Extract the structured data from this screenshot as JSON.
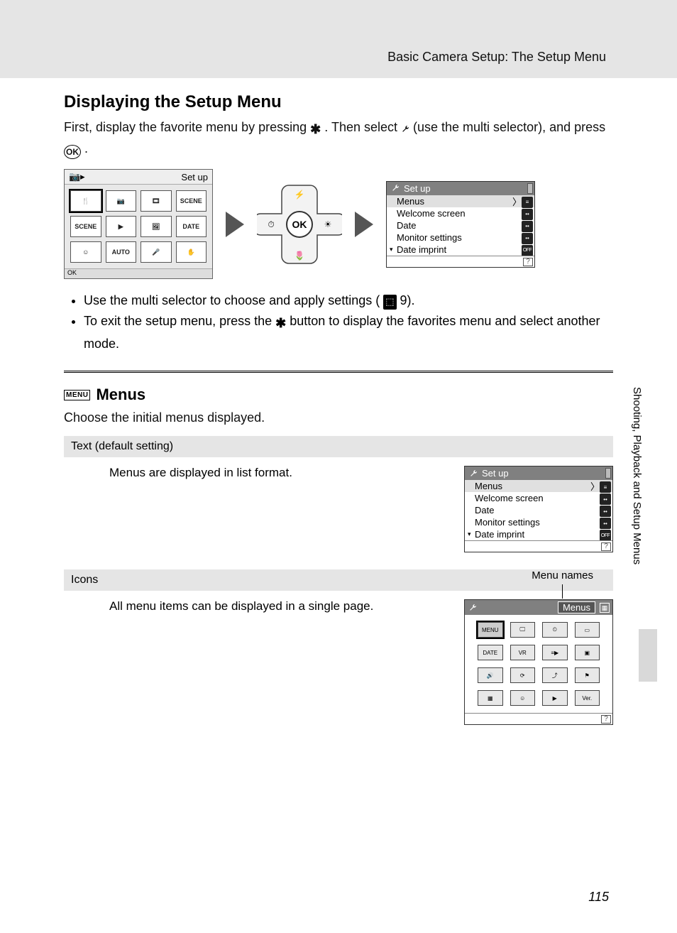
{
  "running_head": "Basic Camera Setup: The Setup Menu",
  "section1": {
    "title": "Displaying the Setup Menu",
    "intro_a": "First, display the favorite menu by pressing ",
    "intro_b": ". Then select ",
    "intro_c": " (use the multi selector), and press ",
    "intro_d": "."
  },
  "fav_panel": {
    "head_right": "Set up",
    "foot": "OK",
    "cells": [
      "🍴",
      "📷",
      "🎞",
      "SCENE",
      "SCENE",
      "▶",
      "🖼",
      "DATE",
      "☺",
      "AUTO",
      "🎤",
      "✋"
    ]
  },
  "setup_panel": {
    "title": "Set up",
    "rows": [
      {
        "label": "Menus",
        "badge": "≡",
        "sel": true
      },
      {
        "label": "Welcome screen",
        "badge": "••"
      },
      {
        "label": "Date",
        "badge": "••"
      },
      {
        "label": "Monitor settings",
        "badge": "••"
      },
      {
        "label": "Date imprint",
        "badge": "OFF",
        "tri": true
      }
    ]
  },
  "bullets": {
    "b1a": "Use the multi selector to choose and apply settings (",
    "b1b": " 9).",
    "b2a": "To exit the setup menu, press the ",
    "b2b": " button to display the favorites menu and select another mode."
  },
  "menus_section": {
    "icon_text": "MENU",
    "title": "Menus",
    "intro": "Choose the initial menus displayed."
  },
  "opt_text": {
    "header": "Text (default setting)",
    "desc": "Menus are displayed in list format."
  },
  "opt_icons": {
    "header": "Icons",
    "desc": "All menu items can be displayed in a single page.",
    "callout": "Menu names"
  },
  "icons_panel": {
    "title": "Menus",
    "cells": [
      "MENU",
      "🖵",
      "⏲",
      "▭",
      "DATE",
      "VR",
      "≡▶",
      "▣",
      "🔊",
      "⟳",
      "⤴",
      "⚑",
      "▦",
      "☺",
      "▶",
      "Ver."
    ]
  },
  "side_label": "Shooting, Playback and Setup Menus",
  "page_number": "115"
}
